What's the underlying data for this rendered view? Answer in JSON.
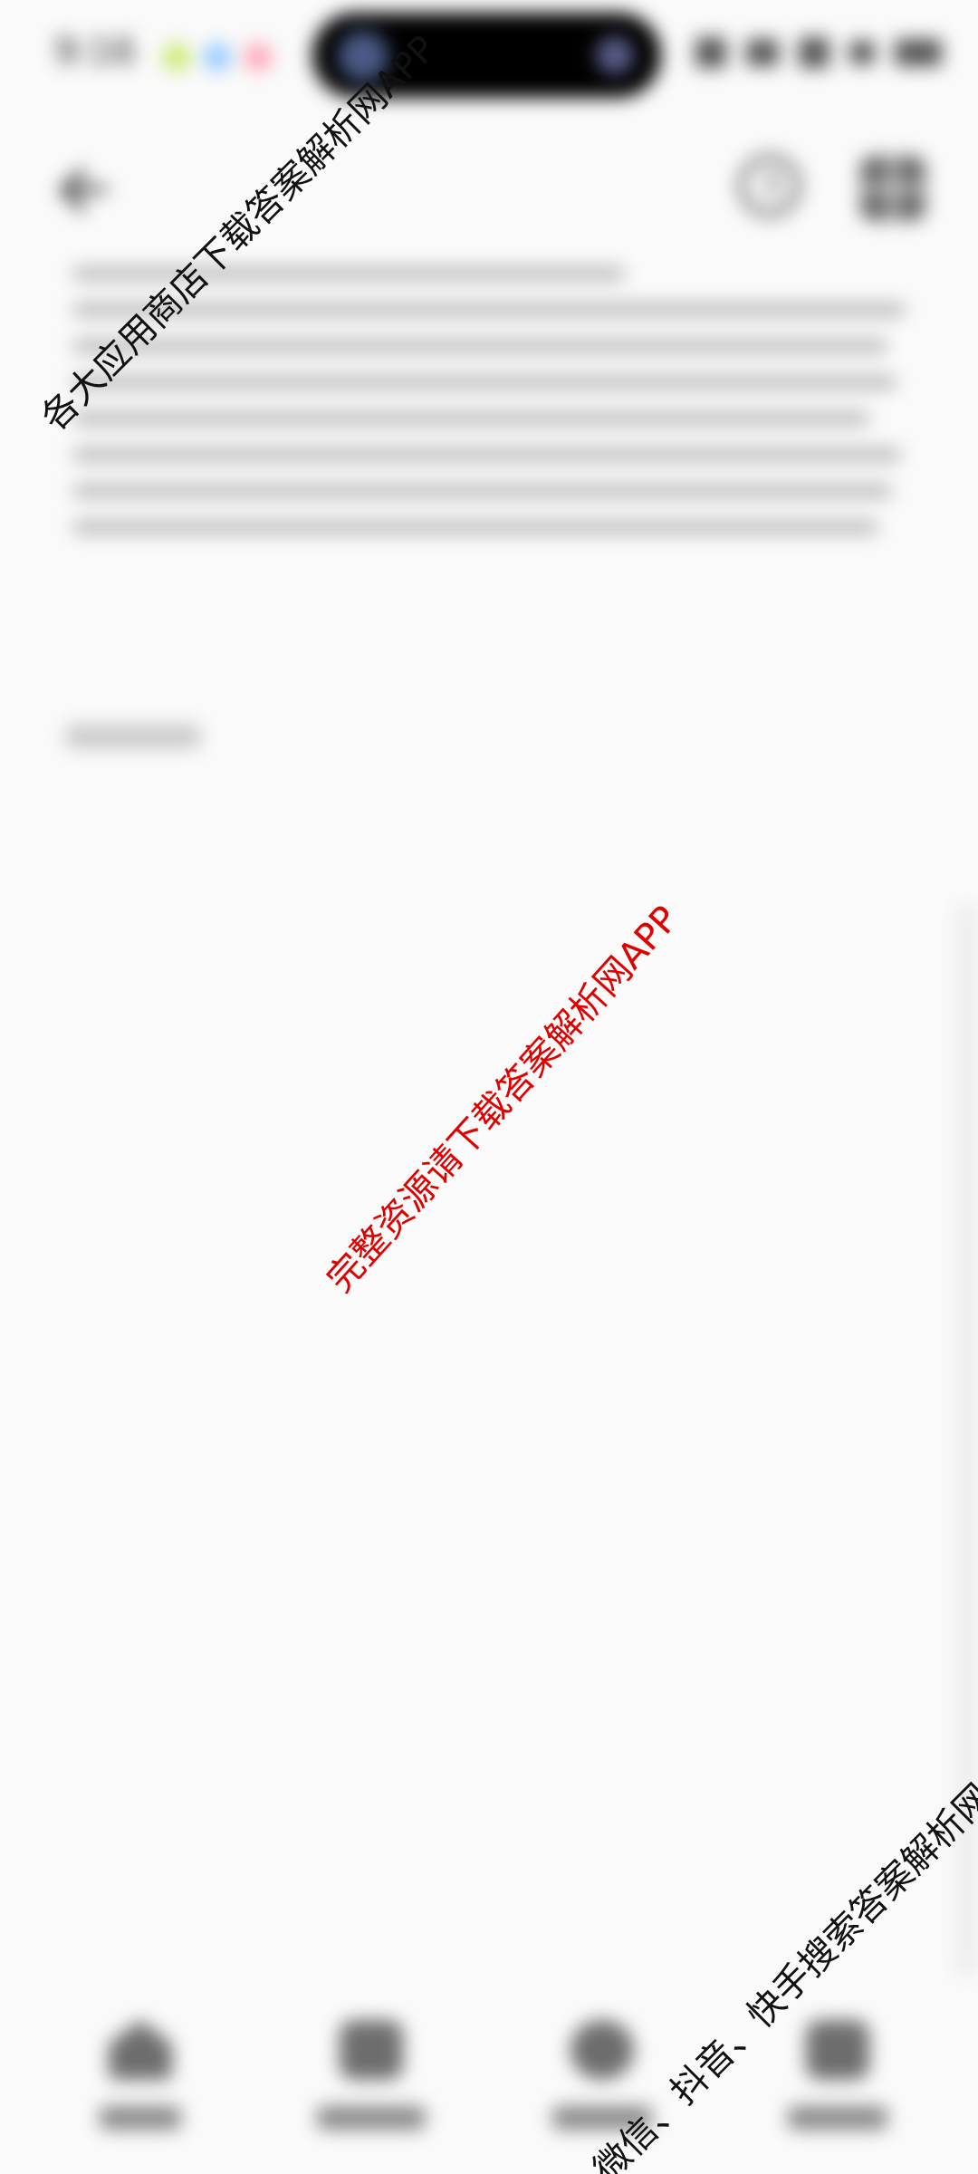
{
  "status_bar": {
    "time": "9:16",
    "dot_colors": [
      "#c7e86a",
      "#8ec7ff",
      "#ffa0b4"
    ]
  },
  "header": {
    "back_icon": "back-arrow-icon",
    "history_icon": "clock-icon",
    "grid_icon": "grid-icon"
  },
  "content": {
    "text_line_count": 8,
    "small_label": ""
  },
  "bottom_nav": {
    "items": [
      {
        "icon": "home-icon",
        "label": ""
      },
      {
        "icon": "catalog-icon",
        "label": ""
      },
      {
        "icon": "grid-icon",
        "label": ""
      },
      {
        "icon": "profile-icon",
        "label": ""
      }
    ]
  },
  "watermarks": {
    "top_left": "各大应用商店下载答案解析网APP",
    "center": "完整资源请下载答案解析网APP",
    "bottom_right": "微信、抖音、快手搜索答案解析网"
  },
  "colors": {
    "background": "#fafafa",
    "center_watermark": "#e00000",
    "corner_watermark": "#111111"
  }
}
